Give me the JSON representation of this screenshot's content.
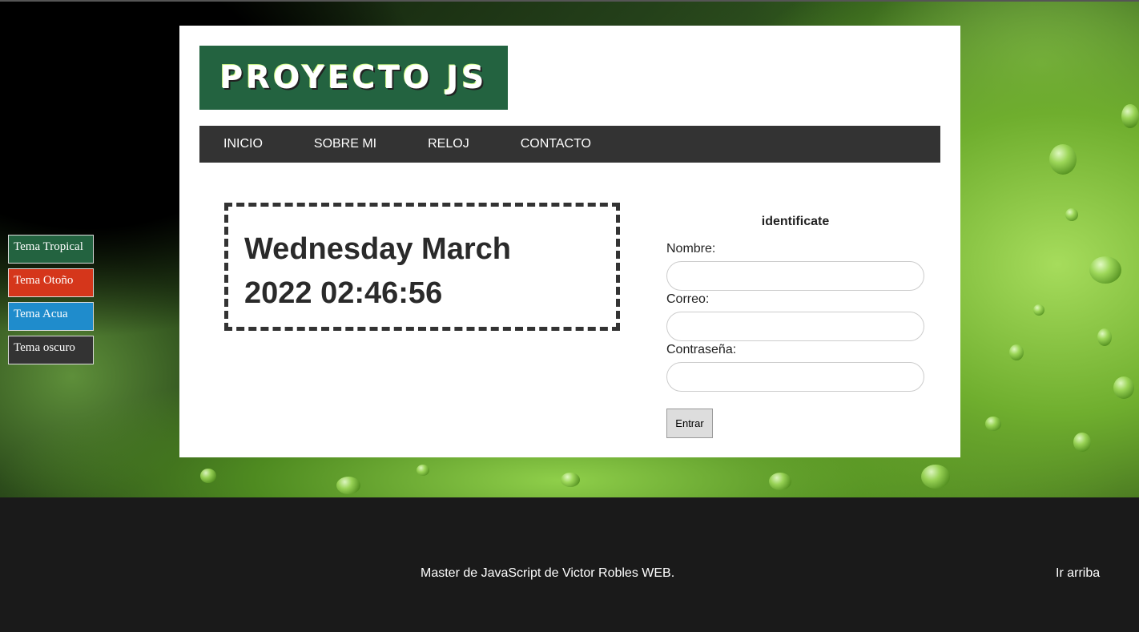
{
  "header": {
    "logo_text": "PROYECTO JS"
  },
  "nav": {
    "items": [
      {
        "label": "INICIO"
      },
      {
        "label": "SOBRE MI"
      },
      {
        "label": "RELOJ"
      },
      {
        "label": "CONTACTO"
      }
    ]
  },
  "themes": [
    {
      "label": "Tema Tropical",
      "color": "#236340"
    },
    {
      "label": "Tema Otoño",
      "color": "#d5361b"
    },
    {
      "label": "Tema Acua",
      "color": "#1f8ccc"
    },
    {
      "label": "Tema oscuro",
      "color": "#333333"
    }
  ],
  "clock": {
    "line1": "Wednesday March",
    "line2": "2022 02:46:56"
  },
  "login": {
    "title": "identificate",
    "name_label": "Nombre:",
    "name_value": "",
    "email_label": "Correo:",
    "email_value": "",
    "password_label": "Contraseña:",
    "password_value": "",
    "submit_label": "Entrar"
  },
  "footer": {
    "text": "Master de JavaScript de Victor Robles WEB.",
    "top_link": "Ir arriba"
  }
}
